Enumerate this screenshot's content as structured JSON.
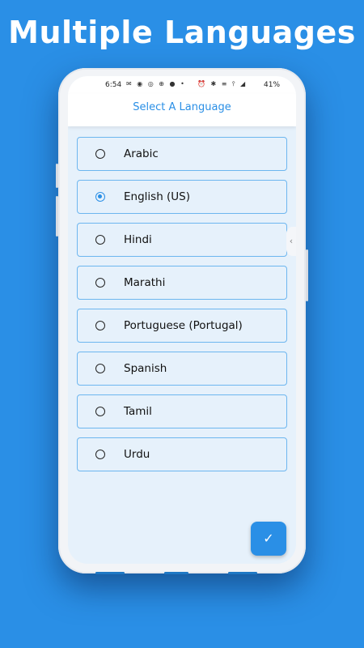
{
  "headline": "Multiple Languages",
  "status_bar": {
    "time": "6:54",
    "left_icons": "✉ ◉ ◎ ⊕ ● •",
    "right_icons": "⏰ ✱ ≡ ⫯ ◢",
    "battery": "41%"
  },
  "app_bar": {
    "title": "Select A Language"
  },
  "languages": [
    {
      "label": "Arabic",
      "selected": false
    },
    {
      "label": "English (US)",
      "selected": true
    },
    {
      "label": "Hindi",
      "selected": false
    },
    {
      "label": "Marathi",
      "selected": false
    },
    {
      "label": "Portuguese (Portugal)",
      "selected": false
    },
    {
      "label": "Spanish",
      "selected": false
    },
    {
      "label": "Tamil",
      "selected": false
    },
    {
      "label": "Urdu",
      "selected": false
    }
  ],
  "fab": {
    "icon": "check-icon",
    "glyph": "✓"
  },
  "edge_tab": {
    "icon": "chevron-left-icon",
    "glyph": "‹"
  },
  "colors": {
    "background": "#2a8fe6",
    "accent": "#2a8fe6",
    "item_border": "#6db6ef",
    "screen_bg": "#e6f1fb"
  }
}
